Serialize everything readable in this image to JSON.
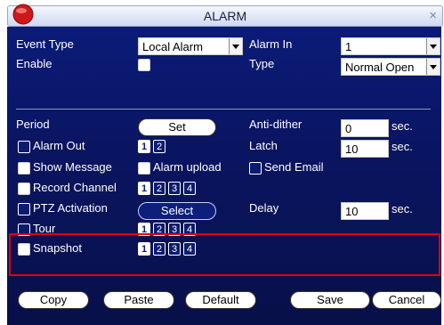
{
  "window": {
    "title": "ALARM",
    "close_glyph": "×"
  },
  "fields": {
    "event_type_label": "Event Type",
    "event_type_value": "Local Alarm",
    "alarm_in_label": "Alarm In",
    "alarm_in_value": "1",
    "enable_label": "Enable",
    "type_label": "Type",
    "type_value": "Normal Open",
    "period_label": "Period",
    "set_button": "Set",
    "anti_dither_label": "Anti-dither",
    "anti_dither_value": "0",
    "anti_dither_unit": "sec.",
    "alarm_out_label": "Alarm Out",
    "latch_label": "Latch",
    "latch_value": "10",
    "latch_unit": "sec.",
    "show_message_label": "Show Message",
    "alarm_upload_label": "Alarm upload",
    "send_email_label": "Send Email",
    "record_channel_label": "Record Channel",
    "ptz_activation_label": "PTZ Activation",
    "select_button": "Select",
    "delay_label": "Delay",
    "delay_value": "10",
    "delay_unit": "sec.",
    "tour_label": "Tour",
    "snapshot_label": "Snapshot"
  },
  "channels": {
    "alarm_out": [
      "1",
      "2"
    ],
    "record": [
      "1",
      "2",
      "3",
      "4"
    ],
    "tour": [
      "1",
      "2",
      "3",
      "4"
    ],
    "snapshot": [
      "1",
      "2",
      "3",
      "4"
    ]
  },
  "buttons": {
    "copy": "Copy",
    "paste": "Paste",
    "default": "Default",
    "save": "Save",
    "cancel": "Cancel"
  },
  "colors": {
    "panel": "#0a1562",
    "highlight": "#e00000"
  }
}
